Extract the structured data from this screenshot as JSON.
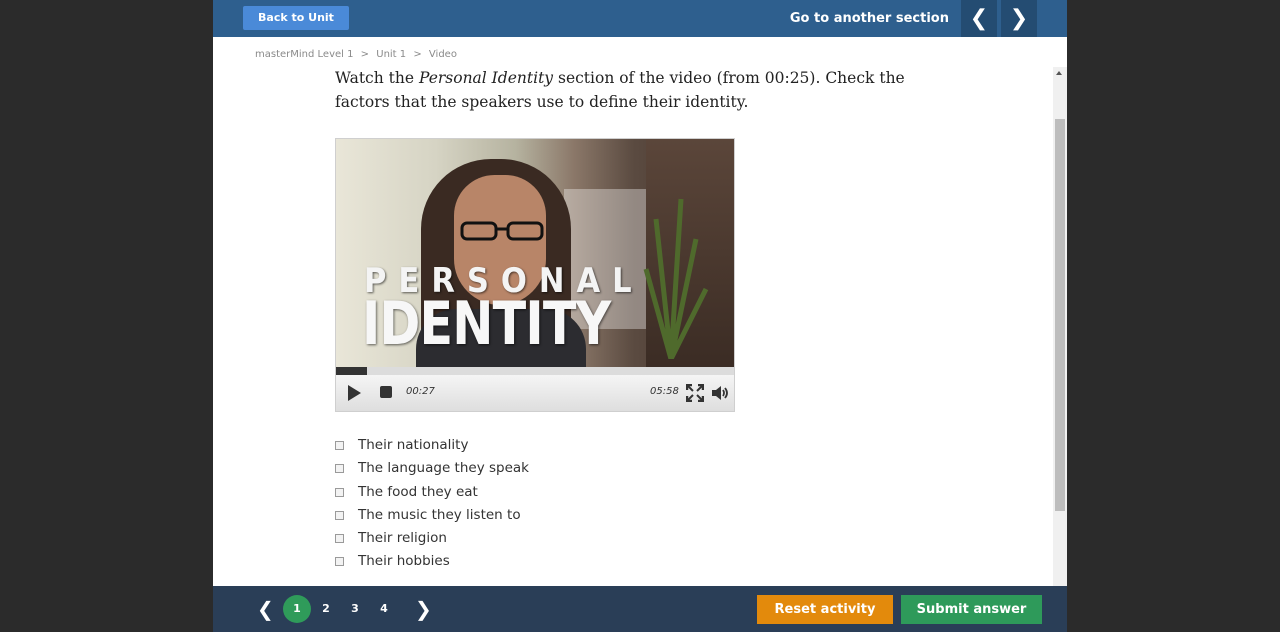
{
  "header": {
    "back_label": "Back to Unit",
    "section_label": "Go to another section",
    "prev_icon": "chevron-left-icon",
    "next_icon": "chevron-right-icon",
    "prev_glyph": "❮",
    "next_glyph": "❯"
  },
  "breadcrumb": {
    "items": [
      "masterMind Level 1",
      "Unit 1",
      "Video"
    ],
    "separator": ">"
  },
  "instruction": {
    "before": "Watch the ",
    "emphasis": "Personal Identity",
    "after": " section of the video (from 00:25). Check the factors that the speakers use to define their identity."
  },
  "video": {
    "overlay_line1": "PERSONAL",
    "overlay_line2": "IDENTITY",
    "current_time": "00:27",
    "total_time": "05:58",
    "progress": 0.077
  },
  "options": [
    {
      "label": "Their nationality",
      "checked": false
    },
    {
      "label": "The language they speak",
      "checked": false
    },
    {
      "label": "The food they eat",
      "checked": false
    },
    {
      "label": "The music they listen to",
      "checked": false
    },
    {
      "label": "Their religion",
      "checked": false
    },
    {
      "label": "Their hobbies",
      "checked": false
    }
  ],
  "footer": {
    "prev_glyph": "❮",
    "next_glyph": "❯",
    "pages": [
      "1",
      "2",
      "3",
      "4"
    ],
    "active_page": "1",
    "reset_label": "Reset activity",
    "submit_label": "Submit answer"
  },
  "colors": {
    "topbar": "#2e5f8e",
    "bottombar": "#2a3e57",
    "active_page": "#2f9b5a",
    "reset": "#e38a0c",
    "submit": "#2e9a5a"
  }
}
